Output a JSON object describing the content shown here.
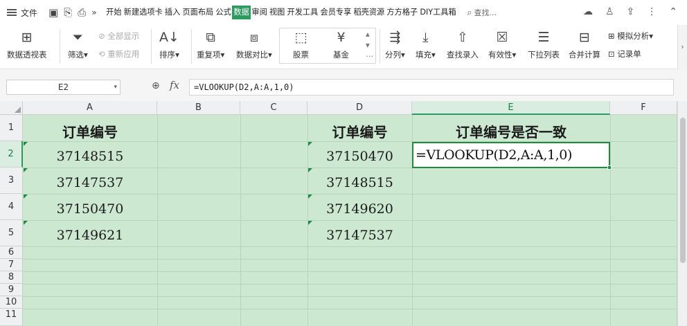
{
  "menu": {
    "file_label": "文件",
    "tabs": [
      "开始",
      "新建选项卡",
      "插入",
      "页面布局",
      "公式",
      "数据",
      "审阅",
      "视图",
      "开发工具",
      "会员专享",
      "稻壳资源",
      "方方格子",
      "DIY工具箱"
    ],
    "active_tab": "数据",
    "search_placeholder": "查找..."
  },
  "ribbon": {
    "pivot_table": "数据透视表",
    "filter": "筛选",
    "show_all": "全部显示",
    "reapply": "重新应用",
    "sort": "排序",
    "duplicates": "重复项",
    "compare": "数据对比",
    "stock": "股票",
    "fund": "基金",
    "split": "分列",
    "fill": "填充",
    "lookup_entry": "查找录入",
    "validity": "有效性",
    "dropdown_list": "下拉列表",
    "consolidate": "合并计算",
    "simulation": "模拟分析",
    "record_sheet": "记录单"
  },
  "formula_bar": {
    "name_box": "E2",
    "fx_label": "fx",
    "formula": "=VLOOKUP(D2,A:A,1,0)"
  },
  "sheet": {
    "columns": [
      "A",
      "B",
      "C",
      "D",
      "E",
      "F"
    ],
    "selected_column": "E",
    "rows": [
      "1",
      "2",
      "3",
      "4",
      "5",
      "6",
      "7",
      "8",
      "9",
      "10",
      "11"
    ],
    "selected_row": "2",
    "cells": {
      "A1": "订单编号",
      "A2": "37148515",
      "A3": "37147537",
      "A4": "37150470",
      "A5": "37149621",
      "D1": "订单编号",
      "D2": "37150470",
      "D3": "37148515",
      "D4": "37149620",
      "D5": "37147537",
      "E1": "订单编号是否一致",
      "E2": "=VLOOKUP(D2,A:A,1,0)"
    }
  }
}
